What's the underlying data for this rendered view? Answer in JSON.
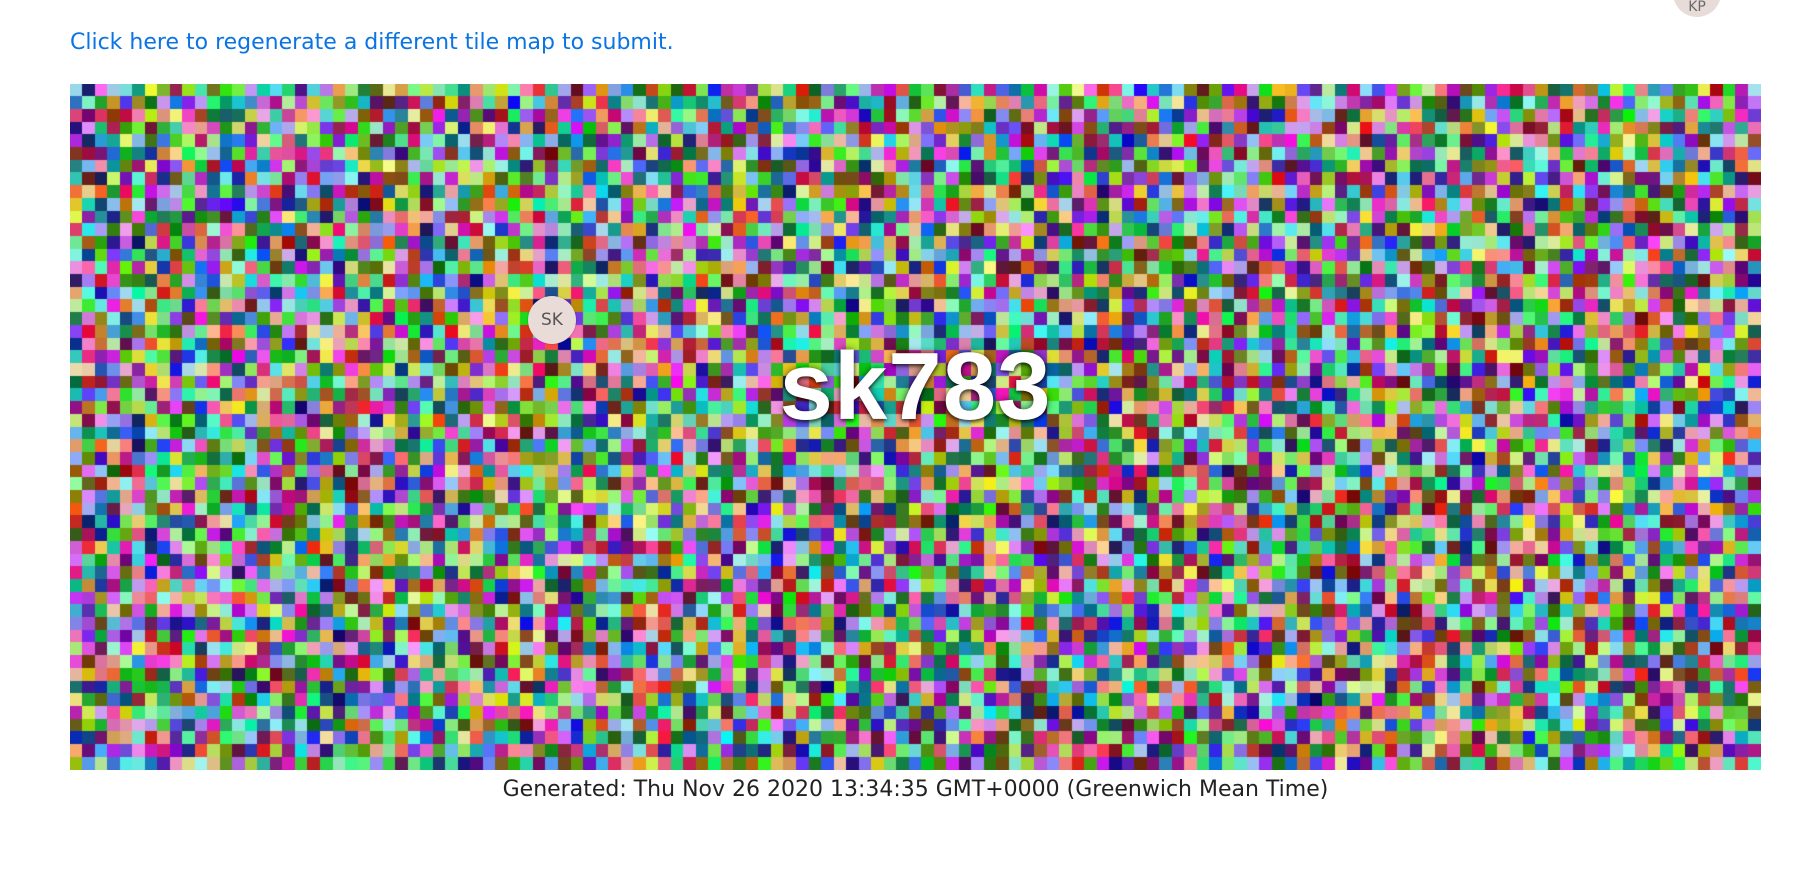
{
  "header": {
    "avatar_initials": "KP",
    "regenerate_link": "Click here to regenerate a different tile map to submit."
  },
  "tilemap": {
    "avatar_initials": "SK",
    "username": "sk783",
    "columns": 135,
    "rows": 54
  },
  "footer": {
    "generated": "Generated: Thu Nov 26 2020 13:34:35 GMT+0000 (Greenwich Mean Time)"
  }
}
